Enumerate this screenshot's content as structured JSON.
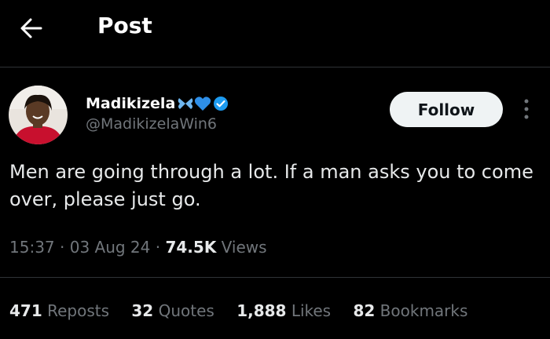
{
  "header": {
    "title": "Post",
    "back_icon": "arrow-left-icon"
  },
  "author": {
    "name": "Madikizela",
    "handle": "@MadikizelaWin6",
    "verified": true,
    "badge_color": "#1d9bf0",
    "emojis": [
      "butterfly-icon",
      "blue-heart-icon"
    ]
  },
  "follow_label": "Follow",
  "post": {
    "text": "Men are going through a lot. If a man asks you to come over, please just go.",
    "time": "15:37",
    "date": "03 Aug 24",
    "views_count": "74.5K",
    "views_label": "Views"
  },
  "stats": {
    "reposts_count": "471",
    "reposts_label": "Reposts",
    "quotes_count": "32",
    "quotes_label": "Quotes",
    "likes_count": "1,888",
    "likes_label": "Likes",
    "bookmarks_count": "82",
    "bookmarks_label": "Bookmarks"
  },
  "colors": {
    "background": "#000000",
    "text": "#e7e9ea",
    "secondary": "#71767b",
    "accent": "#1d9bf0"
  }
}
